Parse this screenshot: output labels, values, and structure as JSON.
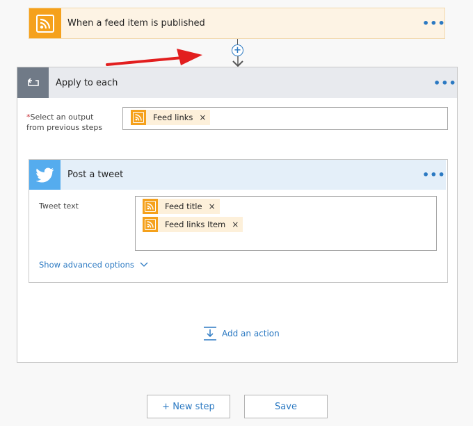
{
  "trigger": {
    "title": "When a feed item is published",
    "more": "•••"
  },
  "connector": {
    "plus": "+"
  },
  "apply_each": {
    "title": "Apply to each",
    "more": "•••",
    "select_required_mark": "*",
    "select_label_line1": "Select an output",
    "select_label_line2": "from previous steps",
    "token": {
      "label": "Feed links",
      "remove": "×"
    }
  },
  "tweet": {
    "title": "Post a tweet",
    "more": "•••",
    "field_label": "Tweet text",
    "tokens": [
      {
        "label": "Feed title",
        "remove": "×"
      },
      {
        "label": "Feed links Item",
        "remove": "×"
      }
    ],
    "advanced": "Show advanced options"
  },
  "add_action": "Add an action",
  "footer": {
    "new_step": "+ New step",
    "save": "Save"
  },
  "colors": {
    "rss": "#f5a11c",
    "twitter": "#55acee",
    "accent": "#2b79c2",
    "arrow": "#e21f1f"
  }
}
